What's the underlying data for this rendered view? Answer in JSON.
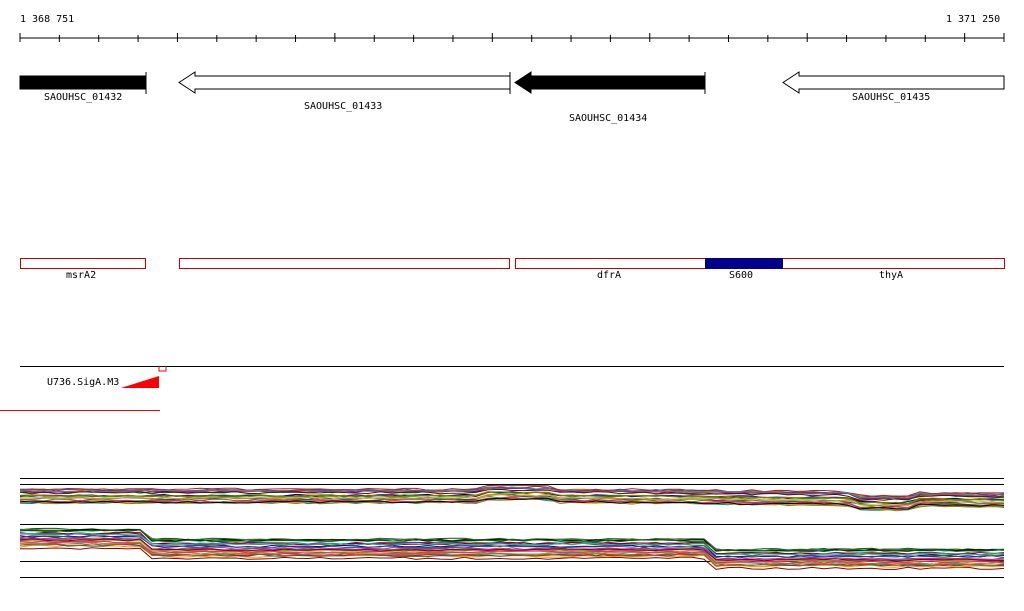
{
  "ruler": {
    "start": "1 368 751",
    "end": "1 371 250"
  },
  "genes": [
    {
      "name": "SAOUHSC_01432",
      "strand": "+",
      "fill": "#000000"
    },
    {
      "name": "SAOUHSC_01433",
      "strand": "-",
      "fill": "#ffffff"
    },
    {
      "name": "SAOUHSC_01434",
      "strand": "-",
      "fill": "#000000"
    },
    {
      "name": "SAOUHSC_01435",
      "strand": "-",
      "fill": "#ffffff"
    }
  ],
  "annotations": [
    {
      "name": "msrA2",
      "color": "#cc0000"
    },
    {
      "name": "",
      "color": "#cc0000"
    },
    {
      "name": "dfrA",
      "color": "#cc0000"
    },
    {
      "name": "S600",
      "color": "#00008b"
    },
    {
      "name": "thyA",
      "color": "#cc0000"
    }
  ],
  "promoter": {
    "name": "U736.SigA.M3",
    "color": "#ff0000"
  },
  "colors": {
    "axis": "#000000",
    "outline_red": "#cc0000",
    "s600": "#00008b",
    "promoter": "#ff0000"
  }
}
